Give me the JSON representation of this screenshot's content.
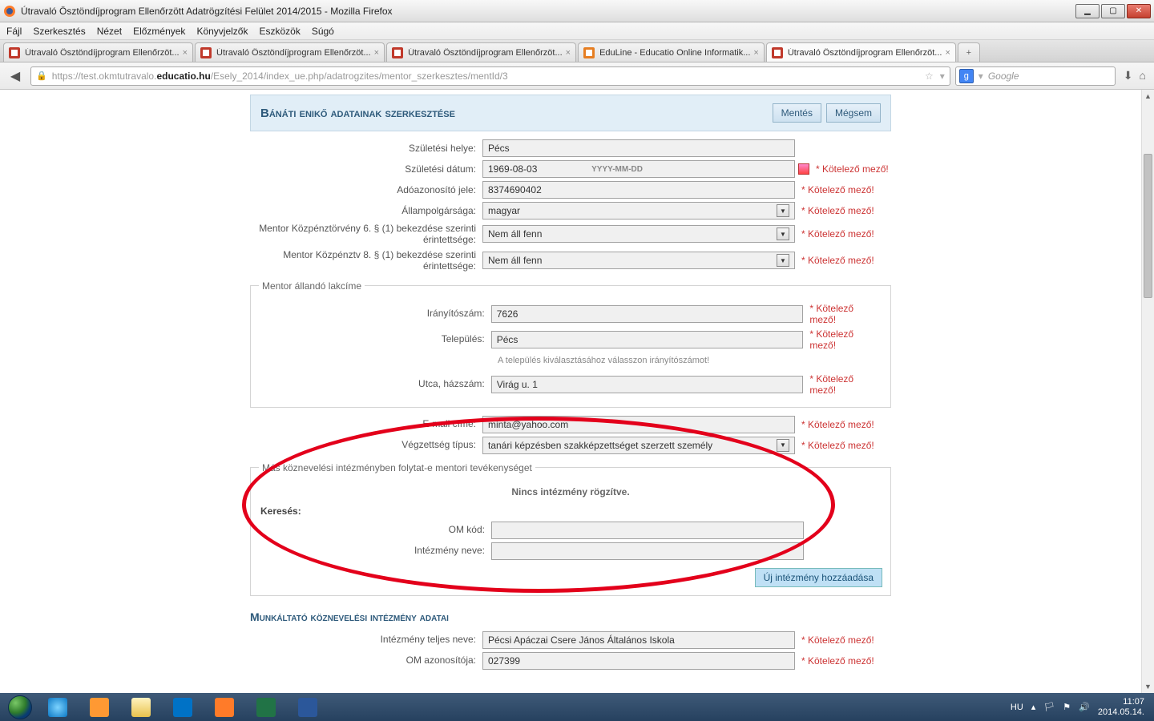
{
  "window": {
    "title": "Útravaló Ösztöndíjprogram Ellenőrzött Adatrögzítési Felület 2014/2015 - Mozilla Firefox"
  },
  "menu": {
    "file": "Fájl",
    "edit": "Szerkesztés",
    "view": "Nézet",
    "hist": "Előzmények",
    "bm": "Könyvjelzők",
    "tools": "Eszközök",
    "help": "Súgó"
  },
  "tabs": [
    "Útravaló Ösztöndíjprogram Ellenőrzöt...",
    "Útravaló Ösztöndíjprogram Ellenőrzöt...",
    "Útravaló Ösztöndíjprogram Ellenőrzöt...",
    "EduLine - Educatio Online Informatik...",
    "Útravaló Ösztöndíjprogram Ellenőrzöt..."
  ],
  "url": {
    "prefix": "https://test.okmtutravalo.",
    "domain": "educatio.hu",
    "path": "/Esely_2014/index_ue.php/adatrogzites/mentor_szerkesztes/mentId/3"
  },
  "search": {
    "placeholder": "Google"
  },
  "page": {
    "heading": "Bánáti enikő adatainak szerkesztése",
    "save": "Mentés",
    "cancel": "Mégsem",
    "labels": {
      "birthplace": "Születési helye:",
      "birthdate": "Születési dátum:",
      "taxid": "Adóazonosító jele:",
      "citizenship": "Állampolgársága:",
      "k6": "Mentor Közpénztörvény 6. § (1) bekezdése szerinti érintettsége:",
      "k8": "Mentor Közpénztv 8. § (1) bekezdése szerinti érintettsége:",
      "addr_legend": "Mentor állandó lakcíme",
      "zip": "Irányítószám:",
      "city": "Település:",
      "city_hint": "A település kiválasztásához válasszon irányítószámot!",
      "street": "Utca, házszám:",
      "email": "E-mail címe:",
      "qual": "Végzettség típus:",
      "other_legend": "Más köznevelési intézményben folytat-e mentori tevékenységet",
      "none_recorded": "Nincs intézmény rögzítve.",
      "search": "Keresés:",
      "om": "OM kód:",
      "instname": "Intézmény neve:",
      "add_inst": "Új intézmény hozzáadása",
      "employer": "Munkáltató köznevelési intézmény adatai",
      "inst_full": "Intézmény teljes neve:",
      "om_id": "OM azonosítója:"
    },
    "values": {
      "birthplace": "Pécs",
      "birthdate": "1969-08-03",
      "datefmt": "YYYY-MM-DD",
      "taxid": "8374690402",
      "citizenship": "magyar",
      "k6": "Nem áll fenn",
      "k8": "Nem áll fenn",
      "zip": "7626",
      "city": "Pécs",
      "street": "Virág u. 1",
      "email": "minta@yahoo.com",
      "qual": "tanári képzésben szakképzettséget szerzett személy",
      "inst_full": "Pécsi Apáczai Csere János Általános Iskola",
      "om_id": "027399"
    },
    "required": "* Kötelező mező!"
  },
  "tray": {
    "lang": "HU",
    "time": "11:07",
    "date": "2014.05.14."
  }
}
